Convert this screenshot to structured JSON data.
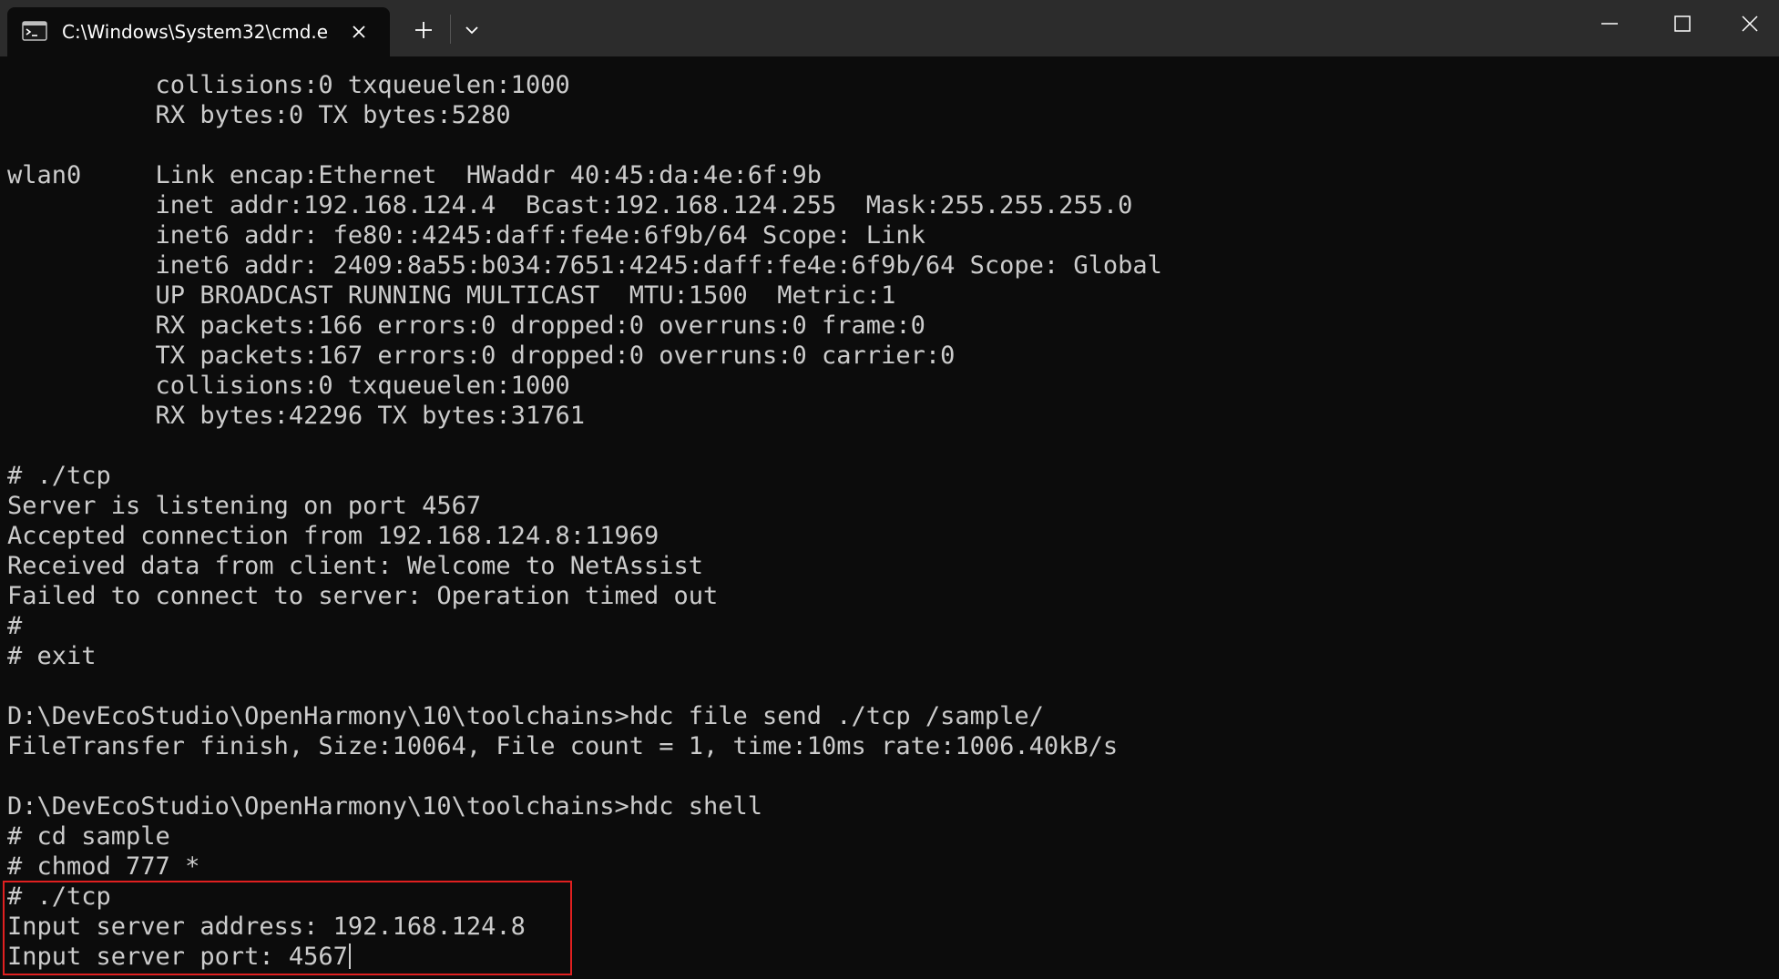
{
  "window": {
    "tab_title": "C:\\Windows\\System32\\cmd.e",
    "icons": {
      "tab": "terminal-icon",
      "close_tab": "close-icon",
      "new_tab": "plus-icon",
      "dropdown": "chevron-down-icon",
      "minimize": "minimize-icon",
      "maximize": "maximize-icon",
      "close_window": "close-icon"
    }
  },
  "console": {
    "lines": [
      "          collisions:0 txqueuelen:1000",
      "          RX bytes:0 TX bytes:5280",
      "",
      "wlan0     Link encap:Ethernet  HWaddr 40:45:da:4e:6f:9b",
      "          inet addr:192.168.124.4  Bcast:192.168.124.255  Mask:255.255.255.0",
      "          inet6 addr: fe80::4245:daff:fe4e:6f9b/64 Scope: Link",
      "          inet6 addr: 2409:8a55:b034:7651:4245:daff:fe4e:6f9b/64 Scope: Global",
      "          UP BROADCAST RUNNING MULTICAST  MTU:1500  Metric:1",
      "          RX packets:166 errors:0 dropped:0 overruns:0 frame:0",
      "          TX packets:167 errors:0 dropped:0 overruns:0 carrier:0",
      "          collisions:0 txqueuelen:1000",
      "          RX bytes:42296 TX bytes:31761",
      "",
      "# ./tcp",
      "Server is listening on port 4567",
      "Accepted connection from 192.168.124.8:11969",
      "Received data from client: Welcome to NetAssist",
      "Failed to connect to server: Operation timed out",
      "#",
      "# exit",
      "",
      "D:\\DevEcoStudio\\OpenHarmony\\10\\toolchains>hdc file send ./tcp /sample/",
      "FileTransfer finish, Size:10064, File count = 1, time:10ms rate:1006.40kB/s",
      "",
      "D:\\DevEcoStudio\\OpenHarmony\\10\\toolchains>hdc shell",
      "# cd sample",
      "# chmod 777 *",
      "# ./tcp",
      "Input server address: 192.168.124.8",
      "Input server port: 4567"
    ]
  },
  "colors": {
    "background": "#0c0c0c",
    "titlebar": "#2c2c2c",
    "text": "#cccccc",
    "highlight_border": "#e02020"
  }
}
